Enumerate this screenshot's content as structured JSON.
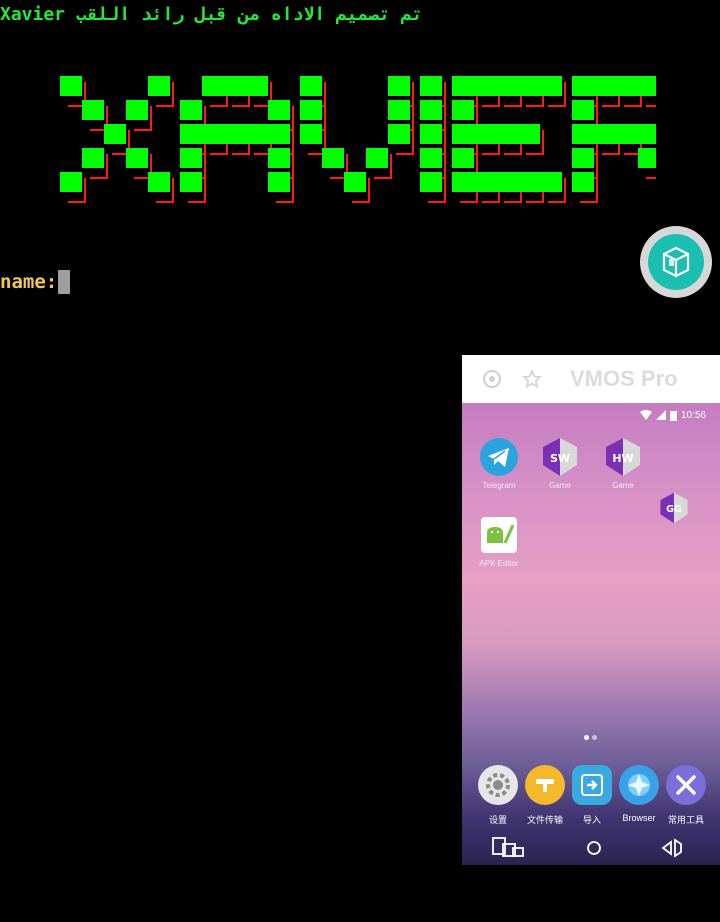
{
  "terminal": {
    "header_text": "Xavier تم تصميم الاداه من قبل رائد اللقب",
    "prompt_label": "name:",
    "banner_text": "XAVIER"
  },
  "colors": {
    "banner_fill": "#00ff00",
    "banner_shadow": "#ff1a1a",
    "header": "#22e83a",
    "prompt": "#f2c94c"
  },
  "floating_button": {
    "icon": "cube-icon"
  },
  "vm_window": {
    "title": "VMOS Pro",
    "status": {
      "time": "10:56"
    },
    "apps": [
      {
        "label": "Telegram",
        "icon": "telegram-icon"
      },
      {
        "label": "Game",
        "icon": "gameguardian-sw-icon",
        "badge": "SW"
      },
      {
        "label": "Game",
        "icon": "gameguardian-hw-icon",
        "badge": "HW"
      },
      {
        "label": "APK Editor",
        "icon": "apk-editor-icon"
      }
    ],
    "floating_gg_badge": "GG",
    "dock": [
      {
        "label": "设置",
        "icon": "settings-icon"
      },
      {
        "label": "文件传输",
        "icon": "file-transfer-icon"
      },
      {
        "label": "导入",
        "icon": "import-icon"
      },
      {
        "label": "Browser",
        "icon": "browser-icon"
      },
      {
        "label": "常用工具",
        "icon": "tools-icon"
      }
    ]
  }
}
